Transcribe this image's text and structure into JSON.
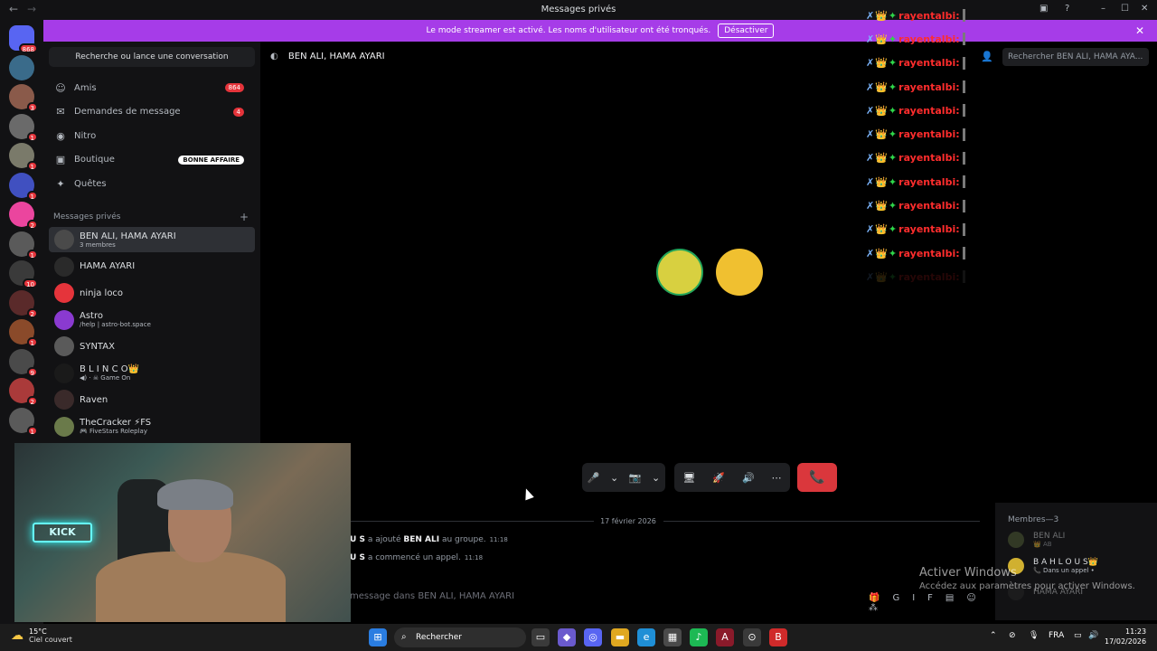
{
  "titlebar": {
    "title": "Messages privés",
    "back": "←",
    "forward": "→"
  },
  "banner": {
    "text": "Le mode streamer est activé. Les noms d'utilisateur ont été tronqués.",
    "button": "Désactiver",
    "close": "✕",
    "color": "#a63ce8"
  },
  "guilds": [
    {
      "badge": "868",
      "color": "#5865f2"
    },
    {
      "badge": "",
      "color": "#3a6b8a"
    },
    {
      "badge": "3",
      "color": "#8a5a4a"
    },
    {
      "badge": "1",
      "color": "#6a6a6a"
    },
    {
      "badge": "1",
      "color": "#7a7a6a"
    },
    {
      "badge": "1",
      "color": "#4050c0"
    },
    {
      "badge": "2",
      "color": "#eb459e"
    },
    {
      "badge": "1",
      "color": "#5a5a5a"
    },
    {
      "badge": "10",
      "color": "#3a3a3a"
    },
    {
      "badge": "2",
      "color": "#5a2a2a"
    },
    {
      "badge": "1",
      "color": "#8a4a2a"
    },
    {
      "badge": "9",
      "color": "#4a4a4a"
    },
    {
      "badge": "2",
      "color": "#aa3a3a"
    },
    {
      "badge": "1",
      "color": "#5a5a5a"
    }
  ],
  "sidebar": {
    "search": "Recherche ou lance une conversation",
    "nav": [
      {
        "label": "Amis",
        "count": "864",
        "icon": "friends-icon",
        "glyph": "☺"
      },
      {
        "label": "Demandes de message",
        "count": "4",
        "icon": "mail-icon",
        "glyph": "✉"
      },
      {
        "label": "Nitro",
        "count": "",
        "icon": "nitro-icon",
        "glyph": "◉"
      },
      {
        "label": "Boutique",
        "deal": "BONNE AFFAIRE",
        "icon": "shop-icon",
        "glyph": "▣"
      },
      {
        "label": "Quêtes",
        "count": "",
        "icon": "compass-icon",
        "glyph": "✦"
      }
    ],
    "dm_header": "Messages privés",
    "dm_plus": "+",
    "dms": [
      {
        "name": "BEN ALI, HAMA AYARI",
        "sub": "3 membres",
        "color": "#4a4a4a"
      },
      {
        "name": "HAMA AYARI",
        "sub": "",
        "color": "#2a2a2a"
      },
      {
        "name": "ninja loco",
        "sub": "",
        "color": "#e5343b"
      },
      {
        "name": "Astro",
        "sub": "/help | astro-bot.space",
        "color": "#8a3ad0"
      },
      {
        "name": "SYNTAX",
        "sub": "",
        "color": "#5a5a5a"
      },
      {
        "name": "B L I N C O👑",
        "sub": "◀) · ☠ Game On",
        "color": "#1a1a1a"
      },
      {
        "name": "Raven",
        "sub": "",
        "color": "#3a2a2a"
      },
      {
        "name": "TheCracker ⚡FS",
        "sub": "🎮 FiveStars Roleplay",
        "color": "#6a7a4a"
      }
    ]
  },
  "main": {
    "title": "BEN ALI, HAMA AYARI",
    "search": "Rechercher BEN ALI, HAMA AYA...",
    "participants": [
      {
        "color": "#d8d040"
      },
      {
        "color": "#f0c030"
      }
    ],
    "controls": {
      "mic": "🎤",
      "cam": "📷",
      "share": "🖥",
      "activity": "🚀",
      "soundboard": "🔊",
      "more": "⋯",
      "hangup": "📞"
    }
  },
  "overlay": {
    "username": "rayentalbi:",
    "lines": 12,
    "x": "✗",
    "crown": "👑",
    "gem": "✦"
  },
  "chat": {
    "date": "17 février 2026",
    "messages": [
      {
        "actor": "U S",
        "text": "a ajouté",
        "target": "BEN ALI",
        "rest": "au groupe.",
        "time": "11:18"
      },
      {
        "actor": "U S",
        "text": "a commencé un appel.",
        "target": "",
        "rest": "",
        "time": "11:18"
      }
    ],
    "composer_placeholder": "message dans BEN ALI, HAMA AYARI",
    "composer_icons": [
      "🎁",
      "GIF",
      "▤",
      "☺",
      "⁂"
    ]
  },
  "members": {
    "header": "Membres—3",
    "list": [
      {
        "name": "BEN ALI",
        "sub": "👑 AB",
        "color": "#5a6a3a"
      },
      {
        "name": "B A H L O U S👑",
        "sub": "📞 Dans un appel •",
        "color": "#d0b030"
      },
      {
        "name": "HAMA AYARI",
        "sub": "",
        "color": "#2a2a2a"
      }
    ]
  },
  "activate": {
    "title": "Activer Windows",
    "text": "Accédez aux paramètres pour activer Windows."
  },
  "webcam": {
    "neon": "KICK"
  },
  "taskbar": {
    "temp": "15°C",
    "weather": "Ciel couvert",
    "search": "Rechercher",
    "apps": [
      {
        "glyph": "⊞",
        "color": "#2a7de1"
      },
      {
        "glyph": "▭",
        "color": "#3a3a3a"
      },
      {
        "glyph": "◆",
        "color": "#6a5acd"
      },
      {
        "glyph": "◎",
        "color": "#5865f2"
      },
      {
        "glyph": "▬",
        "color": "#e0a820"
      },
      {
        "glyph": "e",
        "color": "#1f8fd6"
      },
      {
        "glyph": "▦",
        "color": "#4a4a4a"
      },
      {
        "glyph": "♪",
        "color": "#1db954"
      },
      {
        "glyph": "A",
        "color": "#8a1a2a"
      },
      {
        "glyph": "⊙",
        "color": "#3a3a3a"
      },
      {
        "glyph": "B",
        "color": "#d02a2a"
      }
    ],
    "lang": "FRA",
    "time": "11:23",
    "date": "17/02/2026"
  }
}
